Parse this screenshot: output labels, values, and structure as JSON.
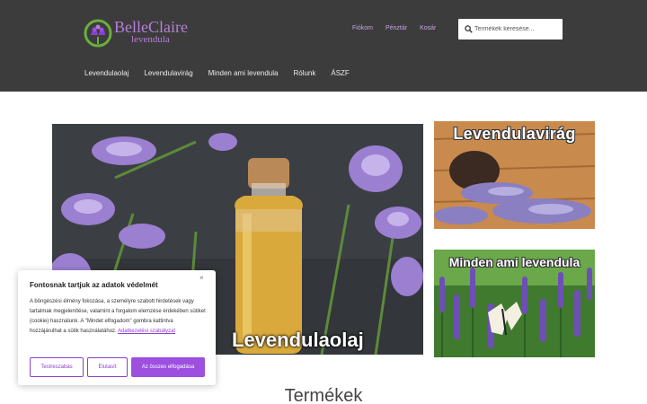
{
  "header": {
    "logo": {
      "name": "BelleClaire",
      "subtitle": "levendula"
    },
    "top_links": [
      "Fiókom",
      "Pénztár",
      "Kosár"
    ],
    "search": {
      "placeholder": "Termékek keresése..."
    },
    "nav": [
      "Levendulaolaj",
      "Levendulavirág",
      "Minden ami levendula",
      "Rólunk",
      "ÁSZF"
    ]
  },
  "main": {
    "hero": {
      "label": "Levendulaolaj"
    },
    "cards": [
      {
        "title": "Levendulavirág"
      },
      {
        "title": "Minden ami levendula"
      }
    ],
    "products_title": "Termékek"
  },
  "cookie": {
    "close_label": "×",
    "title": "Fontosnak tartjuk az adatok védelmét",
    "body": "A böngészési élmény fokozása, a személyre szabott hirdetések vagy tartalmak megjelenítése, valamint a forgalom elemzése érdekében sütiket (cookie) használunk. A \"Mindet elfogadom\" gombra kattintva hozzájárulhat a sütik használatához.",
    "link": "Adatkezelési szabályzat",
    "buttons": {
      "customize": "Testreszabás",
      "reject": "Elutasít",
      "accept": "Az összes elfogadása"
    }
  },
  "colors": {
    "header_bg": "#3c3c3c",
    "accent": "#9d4fe0",
    "logo": "#b57fd6"
  }
}
